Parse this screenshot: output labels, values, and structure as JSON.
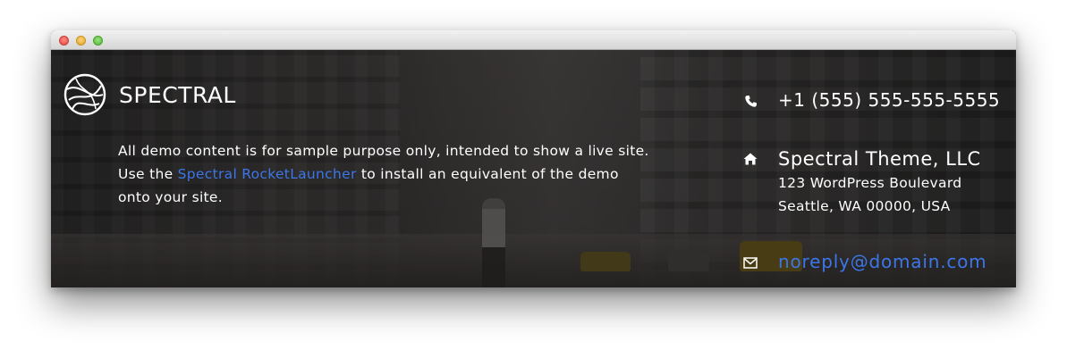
{
  "window": {
    "controls": [
      "close",
      "minimize",
      "zoom"
    ]
  },
  "brand": {
    "name": "SPECTRAL",
    "logo_icon": "spectral-logo-icon"
  },
  "blurb": {
    "text_before_link": "All demo content is for sample purpose only, intended to show a live site. Use the ",
    "link_text": "Spectral RocketLauncher",
    "text_after_link": " to install an equivalent of the demo onto your site."
  },
  "contact": {
    "phone_icon": "phone-icon",
    "phone": "+1 (555) 555-555-5555",
    "address_icon": "home-icon",
    "company": "Spectral Theme, LLC",
    "street": "123 WordPress Boulevard",
    "city": "Seattle, WA 00000, USA",
    "email_icon": "envelope-icon",
    "email": "noreply@domain.com"
  },
  "colors": {
    "link": "#3c76e8",
    "text": "#ffffff",
    "overlay": "#121214"
  }
}
